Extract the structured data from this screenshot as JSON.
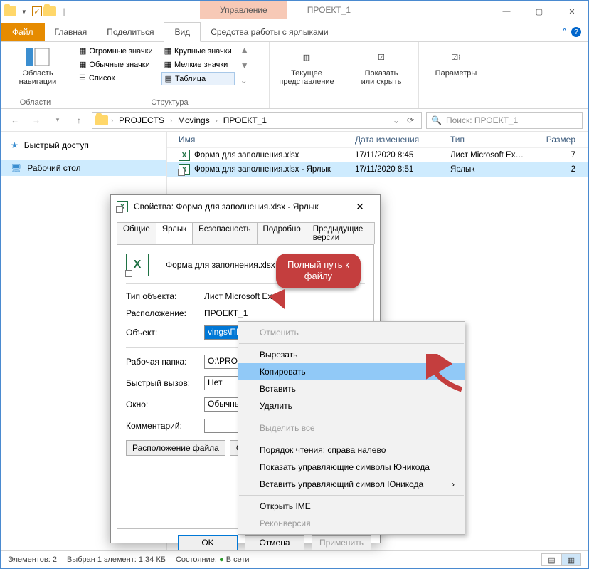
{
  "titlebar": {
    "manage": "Управление",
    "title": "ПРОЕКТ_1"
  },
  "tabs": {
    "file": "Файл",
    "home": "Главная",
    "share": "Поделиться",
    "view": "Вид",
    "tools": "Средства работы с ярлыками"
  },
  "ribbon": {
    "navpane_label": "Область\nнавигации",
    "navpane_group": "Области",
    "huge": "Огромные значки",
    "large": "Крупные значки",
    "normal": "Обычные значки",
    "small": "Мелкие значки",
    "list": "Список",
    "table": "Таблица",
    "struct_group": "Структура",
    "currview": "Текущее\nпредставление",
    "showhide": "Показать\nили скрыть",
    "options": "Параметры"
  },
  "crumbs": [
    "PROJECTS",
    "Movings",
    "ПРОЕКТ_1"
  ],
  "search_placeholder": "Поиск: ПРОЕКТ_1",
  "nav": {
    "quick": "Быстрый доступ",
    "desktop": "Рабочий стол"
  },
  "columns": {
    "name": "Имя",
    "date": "Дата изменения",
    "type": "Тип",
    "size": "Размер"
  },
  "files": [
    {
      "name": "Форма для заполнения.xlsx",
      "date": "17/11/2020 8:45",
      "type": "Лист Microsoft Ex…",
      "size": "7"
    },
    {
      "name": "Форма для заполнения.xlsx - Ярлык",
      "date": "17/11/2020 8:51",
      "type": "Ярлык",
      "size": "2"
    }
  ],
  "dlg": {
    "title": "Свойства: Форма для заполнения.xlsx - Ярлык",
    "tabs": {
      "general": "Общие",
      "shortcut": "Ярлык",
      "security": "Безопасность",
      "details": "Подробно",
      "prev": "Предыдущие версии"
    },
    "link_name": "Форма для заполнения.xlsx - Ярлык",
    "obj_type_l": "Тип объекта:",
    "obj_type_v": "Лист Microsoft Excel",
    "location_l": "Расположение:",
    "location_v": "ПРОЕКТ_1",
    "target_l": "Объект:",
    "target_v": "vings\\ПРОЕКТ_1\\Форма для заполнения.xlsx\"",
    "startin_l": "Рабочая папка:",
    "startin_v": "O:\\PROJECTS",
    "hotkey_l": "Быстрый вызов:",
    "hotkey_v": "Нет",
    "run_l": "Окно:",
    "run_v": "Обычный ра",
    "comment_l": "Комментарий:",
    "comment_v": "",
    "open_loc": "Расположение файла",
    "change_icon": "Смен",
    "ok": "OK",
    "cancel": "Отмена",
    "apply": "Применить"
  },
  "ctx": {
    "undo": "Отменить",
    "cut": "Вырезать",
    "copy": "Копировать",
    "paste": "Вставить",
    "delete": "Удалить",
    "select_all": "Выделить все",
    "rtl": "Порядок чтения: справа налево",
    "show_uni": "Показать управляющие символы Юникода",
    "insert_uni": "Вставить управляющий символ Юникода",
    "open_ime": "Открыть IME",
    "reconv": "Реконверсия"
  },
  "callout": {
    "line1": "Полный путь к",
    "line2": "файлу"
  },
  "status": {
    "count": "Элементов: 2",
    "sel": "Выбран 1 элемент: 1,34 КБ",
    "state_l": "Состояние:",
    "net": "В сети"
  }
}
